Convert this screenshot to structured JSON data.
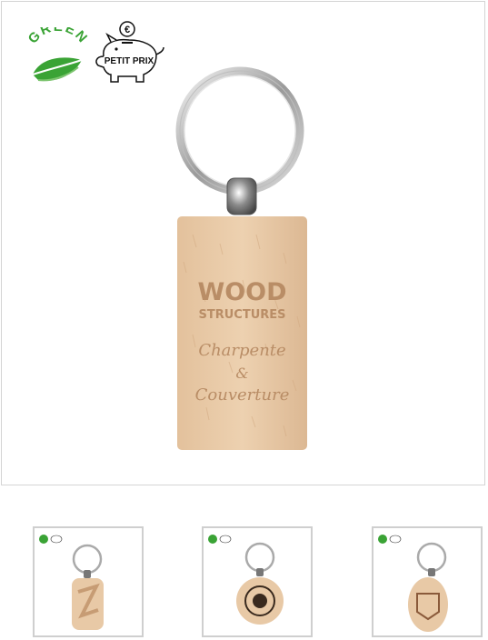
{
  "badges": {
    "green_label": "GREEN",
    "pig_label": "PETIT PRIX",
    "pig_coin": "€"
  },
  "product": {
    "engraving_line1": "WOOD",
    "engraving_line2": "STRUCTURES",
    "engraving_line3": "Charpente",
    "engraving_line4": "&",
    "engraving_line5": "Couverture"
  },
  "thumbnails": [
    {
      "shape": "rounded-rectangle"
    },
    {
      "shape": "round"
    },
    {
      "shape": "oval"
    }
  ],
  "colors": {
    "wood": "#e8c9a6",
    "engraving": "#b98d66",
    "green": "#3aa335",
    "border": "#cfcfcf"
  }
}
